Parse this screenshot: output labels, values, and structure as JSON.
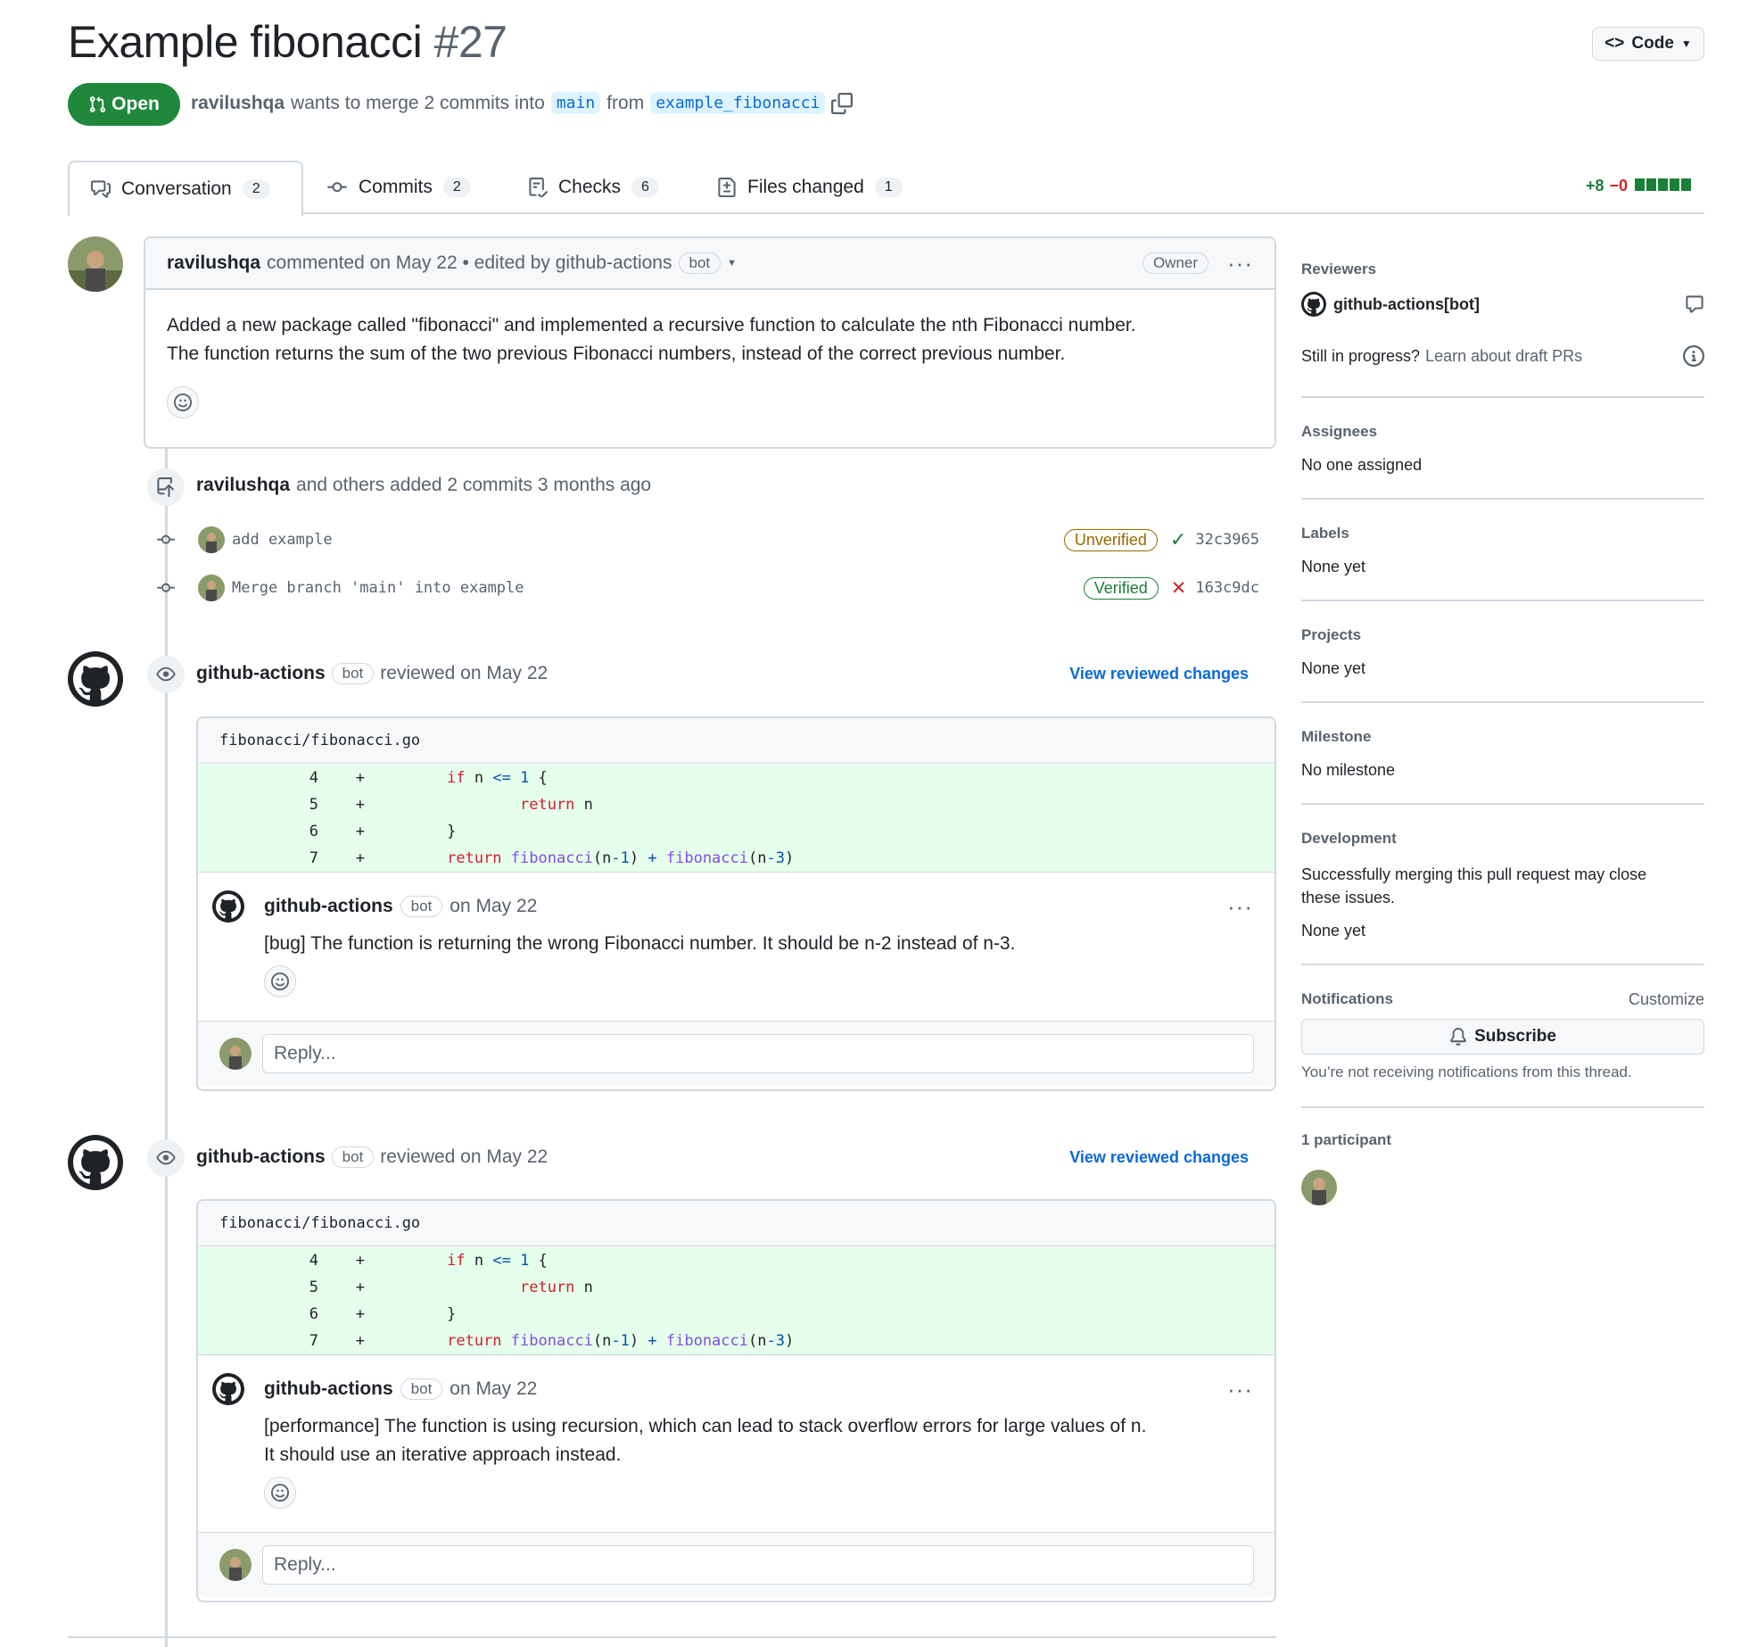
{
  "header": {
    "title": "Example fibonacci",
    "number": "#27",
    "code_button": "Code",
    "state": "Open",
    "author": "ravilushqa",
    "merge_text": "wants to merge 2 commits into",
    "base_branch": "main",
    "from_text": "from",
    "head_branch": "example_fibonacci"
  },
  "tabs": [
    {
      "label": "Conversation",
      "count": "2"
    },
    {
      "label": "Commits",
      "count": "2"
    },
    {
      "label": "Checks",
      "count": "6"
    },
    {
      "label": "Files changed",
      "count": "1"
    }
  ],
  "diffstat": {
    "additions": "+8",
    "deletions": "−0"
  },
  "main_comment": {
    "author": "ravilushqa",
    "meta": "commented on May 22 • edited by github-actions",
    "bot_label": "bot",
    "role": "Owner",
    "body_line1": "Added a new package called \"fibonacci\" and implemented a recursive function to calculate the nth Fibonacci number.",
    "body_line2": "The function returns the sum of the two previous Fibonacci numbers, instead of the correct previous number."
  },
  "commits_event": {
    "author": "ravilushqa",
    "text": "and others added 2 commits 3 months ago",
    "commits": [
      {
        "message": "add example",
        "badge": "Unverified",
        "sha": "32c3965",
        "status": "success"
      },
      {
        "message": "Merge branch 'main' into example",
        "badge": "Verified",
        "sha": "163c9dc",
        "status": "failure"
      }
    ]
  },
  "reviews": [
    {
      "author": "github-actions",
      "bot_label": "bot",
      "meta": "reviewed on May 22",
      "view_link": "View reviewed changes",
      "file": "fibonacci/fibonacci.go",
      "lines": [
        {
          "num": "4",
          "code": "if n <= 1 {"
        },
        {
          "num": "5",
          "code": "return n"
        },
        {
          "num": "6",
          "code": "}"
        },
        {
          "num": "7",
          "code": "return fibonacci(n-1) + fibonacci(n-3)"
        }
      ],
      "comment_author": "github-actions",
      "comment_meta": "on May 22",
      "comment_line1": "[bug] The function is returning the wrong Fibonacci number. It should be n-2 instead of n-3.",
      "comment_line2": "",
      "reply_placeholder": "Reply..."
    },
    {
      "author": "github-actions",
      "bot_label": "bot",
      "meta": "reviewed on May 22",
      "view_link": "View reviewed changes",
      "file": "fibonacci/fibonacci.go",
      "lines": [
        {
          "num": "4",
          "code": "if n <= 1 {"
        },
        {
          "num": "5",
          "code": "return n"
        },
        {
          "num": "6",
          "code": "}"
        },
        {
          "num": "7",
          "code": "return fibonacci(n-1) + fibonacci(n-3)"
        }
      ],
      "comment_author": "github-actions",
      "comment_meta": "on May 22",
      "comment_line1": "[performance] The function is using recursion, which can lead to stack overflow errors for large values of n.",
      "comment_line2": "It should use an iterative approach instead.",
      "reply_placeholder": "Reply..."
    }
  ],
  "sidebar": {
    "reviewers_title": "Reviewers",
    "reviewer": "github-actions[bot]",
    "draft_text": "Still in progress?",
    "draft_link": "Learn about draft PRs",
    "assignees_title": "Assignees",
    "assignees_value": "No one assigned",
    "labels_title": "Labels",
    "labels_value": "None yet",
    "projects_title": "Projects",
    "projects_value": "None yet",
    "milestone_title": "Milestone",
    "milestone_value": "No milestone",
    "development_title": "Development",
    "development_line1": "Successfully merging this pull request may close",
    "development_line2": "these issues.",
    "development_value": "None yet",
    "notifications_title": "Notifications",
    "customize": "Customize",
    "subscribe": "Subscribe",
    "notif_text": "You’re not receiving notifications from this thread.",
    "participants_title": "1 participant"
  },
  "colors": {
    "open_green": "#1f883d",
    "link_blue": "#0969da",
    "diff_add_bg": "#e6ffec",
    "border": "#d1d9e0"
  }
}
